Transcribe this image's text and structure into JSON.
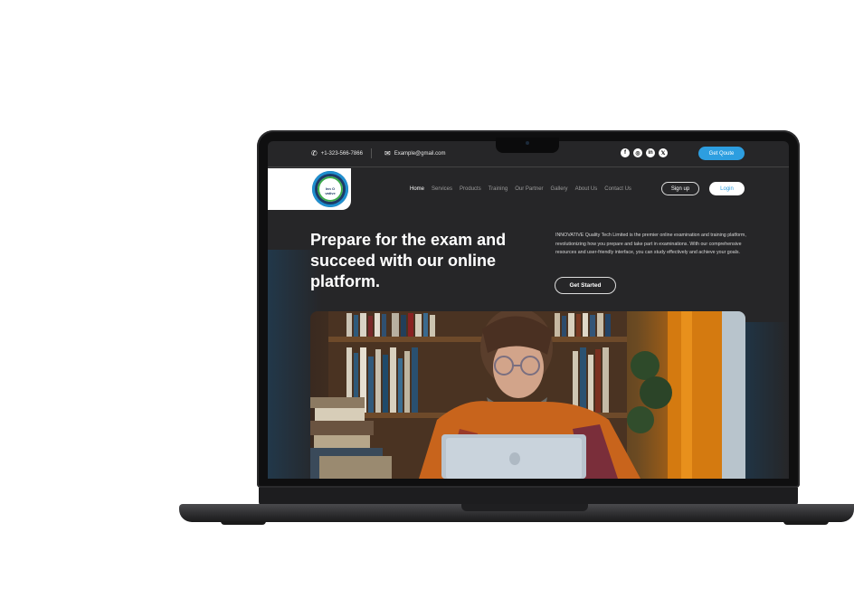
{
  "topbar": {
    "phone": "+1-323-566-7866",
    "email": "Example@gmail.com",
    "socials": [
      {
        "icon": "facebook-icon",
        "glyph": "f"
      },
      {
        "icon": "instagram-icon",
        "glyph": "◎"
      },
      {
        "icon": "linkedin-icon",
        "glyph": "in"
      },
      {
        "icon": "x-twitter-icon",
        "glyph": "𝕏"
      }
    ],
    "quote_label": "Get Qoute"
  },
  "logo": {
    "text": "Inn O vative"
  },
  "nav": {
    "items": [
      "Home",
      "Services",
      "Products",
      "Training",
      "Our Partner",
      "Gallery",
      "About Us",
      "Contact Us"
    ],
    "signup_label": "Sign up",
    "login_label": "Login"
  },
  "hero": {
    "title": "Prepare for the exam and succeed with our online platform.",
    "description": "INNOVATIVE Quality Tech Limited is the premier online examination and training platform, revolutionizing how you prepare and take part in examinations. With our comprehensive resources and user-friendly interface, you can study effectively and achieve your goals.",
    "cta_label": "Get Started"
  },
  "colors": {
    "accent": "#2d9ee0",
    "background": "#262628"
  }
}
